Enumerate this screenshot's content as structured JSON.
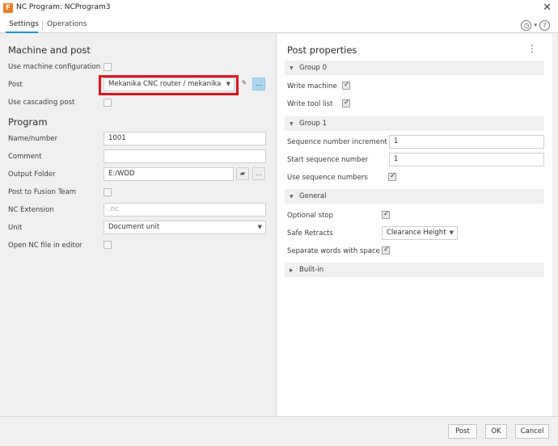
{
  "window": {
    "title": "NC Program: NCProgram3",
    "app_icon_letter": "F"
  },
  "tabs": [
    {
      "label": "Settings",
      "active": true
    },
    {
      "label": "Operations",
      "active": false
    }
  ],
  "toolbar_icons": [
    "clock-icon",
    "chevron-down-icon",
    "help-icon"
  ],
  "machine_and_post": {
    "title": "Machine and post",
    "use_machine_config_label": "Use machine configuration",
    "use_machine_config_checked": false,
    "post_label": "Post",
    "post_value": "Mekanika CNC router / mekanika",
    "use_cascading_post_label": "Use cascading post",
    "use_cascading_post_checked": false
  },
  "program": {
    "title": "Program",
    "name_label": "Name/number",
    "name_value": "1001",
    "comment_label": "Comment",
    "comment_value": "",
    "output_folder_label": "Output Folder",
    "output_folder_value": "E:/WDD",
    "post_to_team_label": "Post to Fusion Team",
    "post_to_team_checked": false,
    "nc_extension_label": "NC Extension",
    "nc_extension_placeholder": ".nc",
    "unit_label": "Unit",
    "unit_value": "Document unit",
    "open_nc_label": "Open NC file in editor",
    "open_nc_checked": false
  },
  "post_properties": {
    "title": "Post properties",
    "groups": [
      {
        "label": "Group 0",
        "expanded": true
      },
      {
        "label": "Group 1",
        "expanded": true
      },
      {
        "label": "General",
        "expanded": true
      },
      {
        "label": "Built-in",
        "expanded": false
      }
    ],
    "write_machine_label": "Write machine",
    "write_machine_checked": true,
    "write_tool_list_label": "Write tool list",
    "write_tool_list_checked": true,
    "seq_increment_label": "Sequence number increment",
    "seq_increment_value": "1",
    "start_seq_label": "Start sequence number",
    "start_seq_value": "1",
    "use_seq_label": "Use sequence numbers",
    "use_seq_checked": true,
    "optional_stop_label": "Optional stop",
    "optional_stop_checked": true,
    "safe_retracts_label": "Safe Retracts",
    "safe_retracts_value": "Clearance Height",
    "separate_words_label": "Separate words with space",
    "separate_words_checked": true
  },
  "footer": {
    "post_label": "Post",
    "ok_label": "OK",
    "cancel_label": "Cancel"
  }
}
